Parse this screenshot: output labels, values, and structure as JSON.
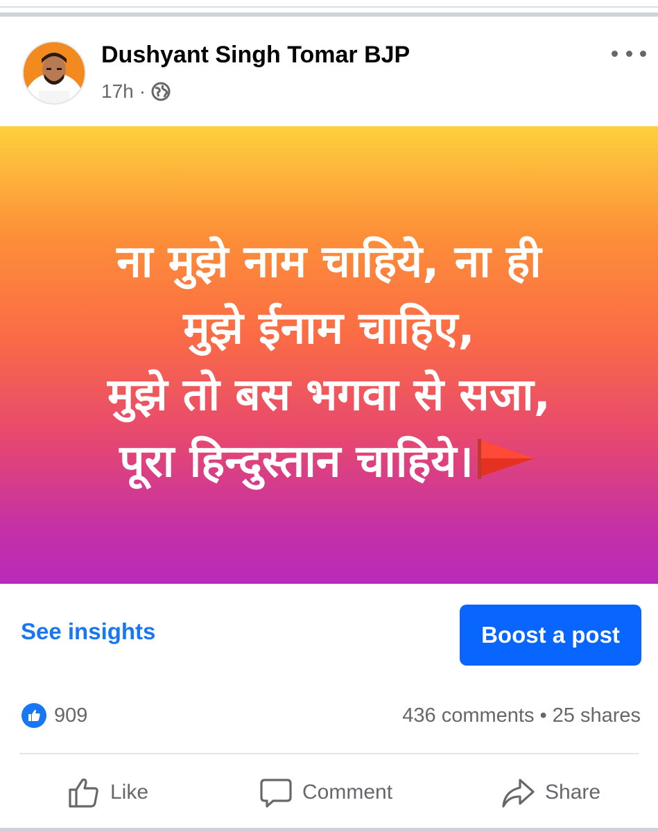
{
  "post": {
    "author": "Dushyant Singh Tomar BJP",
    "time": "17h",
    "separator": "·",
    "image_text": {
      "line1": "ना मुझे नाम चाहिये, ना ही",
      "line2": "मुझे ईनाम चाहिए,",
      "line3": "मुझे तो बस भगवा से सजा,",
      "line4": "पूरा हिन्दुस्तान चाहिये।"
    }
  },
  "actions": {
    "see_insights": "See insights",
    "boost": "Boost a post"
  },
  "stats": {
    "likes": "909",
    "comments": "436 comments",
    "dot": "•",
    "shares": "25 shares"
  },
  "bar": {
    "like": "Like",
    "comment": "Comment",
    "share": "Share"
  },
  "colors": {
    "accent": "#1877f2",
    "boost_bg": "#0866ff",
    "muted_text": "#65676b",
    "gradient": [
      "#fdd03d",
      "#fd8f38",
      "#fb6b46",
      "#e6486f",
      "#c530a6",
      "#b82bba"
    ]
  },
  "icons": {
    "globe": "globe-icon",
    "more": "more-icon",
    "flag": "flag-icon",
    "like": "thumbs-up-icon",
    "comment": "comment-icon",
    "share": "share-icon"
  }
}
